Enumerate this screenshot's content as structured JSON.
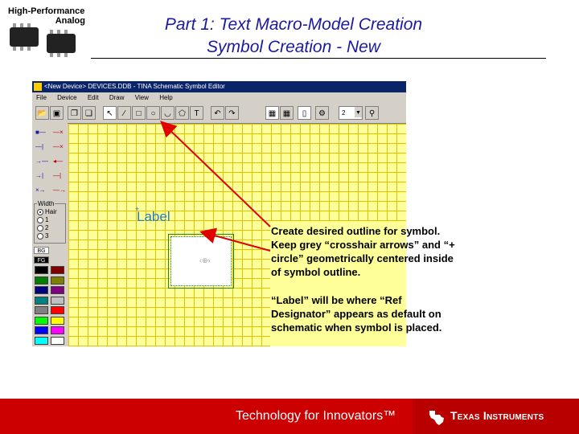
{
  "logo": {
    "line1": "High-Performance",
    "line2": "Analog"
  },
  "slide": {
    "title_line1": "Part 1: Text Macro-Model Creation",
    "title_line2": "Symbol Creation - New"
  },
  "window": {
    "title": "<New Device> DEVICES.DDB - TINA Schematic Symbol Editor",
    "menu": [
      "File",
      "Device",
      "Edit",
      "Draw",
      "View",
      "Help"
    ],
    "zoom_value": "2"
  },
  "sidebar": {
    "width_label": "Width",
    "width_options": [
      "Hair",
      "1",
      "2",
      "3"
    ],
    "bg_label": "BG",
    "fg_label": "FG",
    "colors": [
      "#000000",
      "#800000",
      "#008000",
      "#808000",
      "#000080",
      "#800080",
      "#008080",
      "#c0c0c0",
      "#808080",
      "#ff0000",
      "#00ff00",
      "#ffff00",
      "#0000ff",
      "#ff00ff",
      "#00ffff",
      "#ffffff"
    ]
  },
  "canvas": {
    "label_text": "Label"
  },
  "callout": {
    "p1": "Create desired outline for symbol. Keep grey “crosshair arrows” and “+ circle” geometrically centered inside of symbol outline.",
    "p2": "“Label” will be where “Ref Designator” appears as default on schematic when symbol is placed."
  },
  "footer": {
    "tagline": "Technology for Innovators™",
    "brand": "Texas Instruments"
  },
  "colors": {
    "footer_red": "#cc0000",
    "title_blue": "#1a1aa0",
    "arrow_red": "#e00000",
    "canvas_yellow": "#ffff99"
  }
}
